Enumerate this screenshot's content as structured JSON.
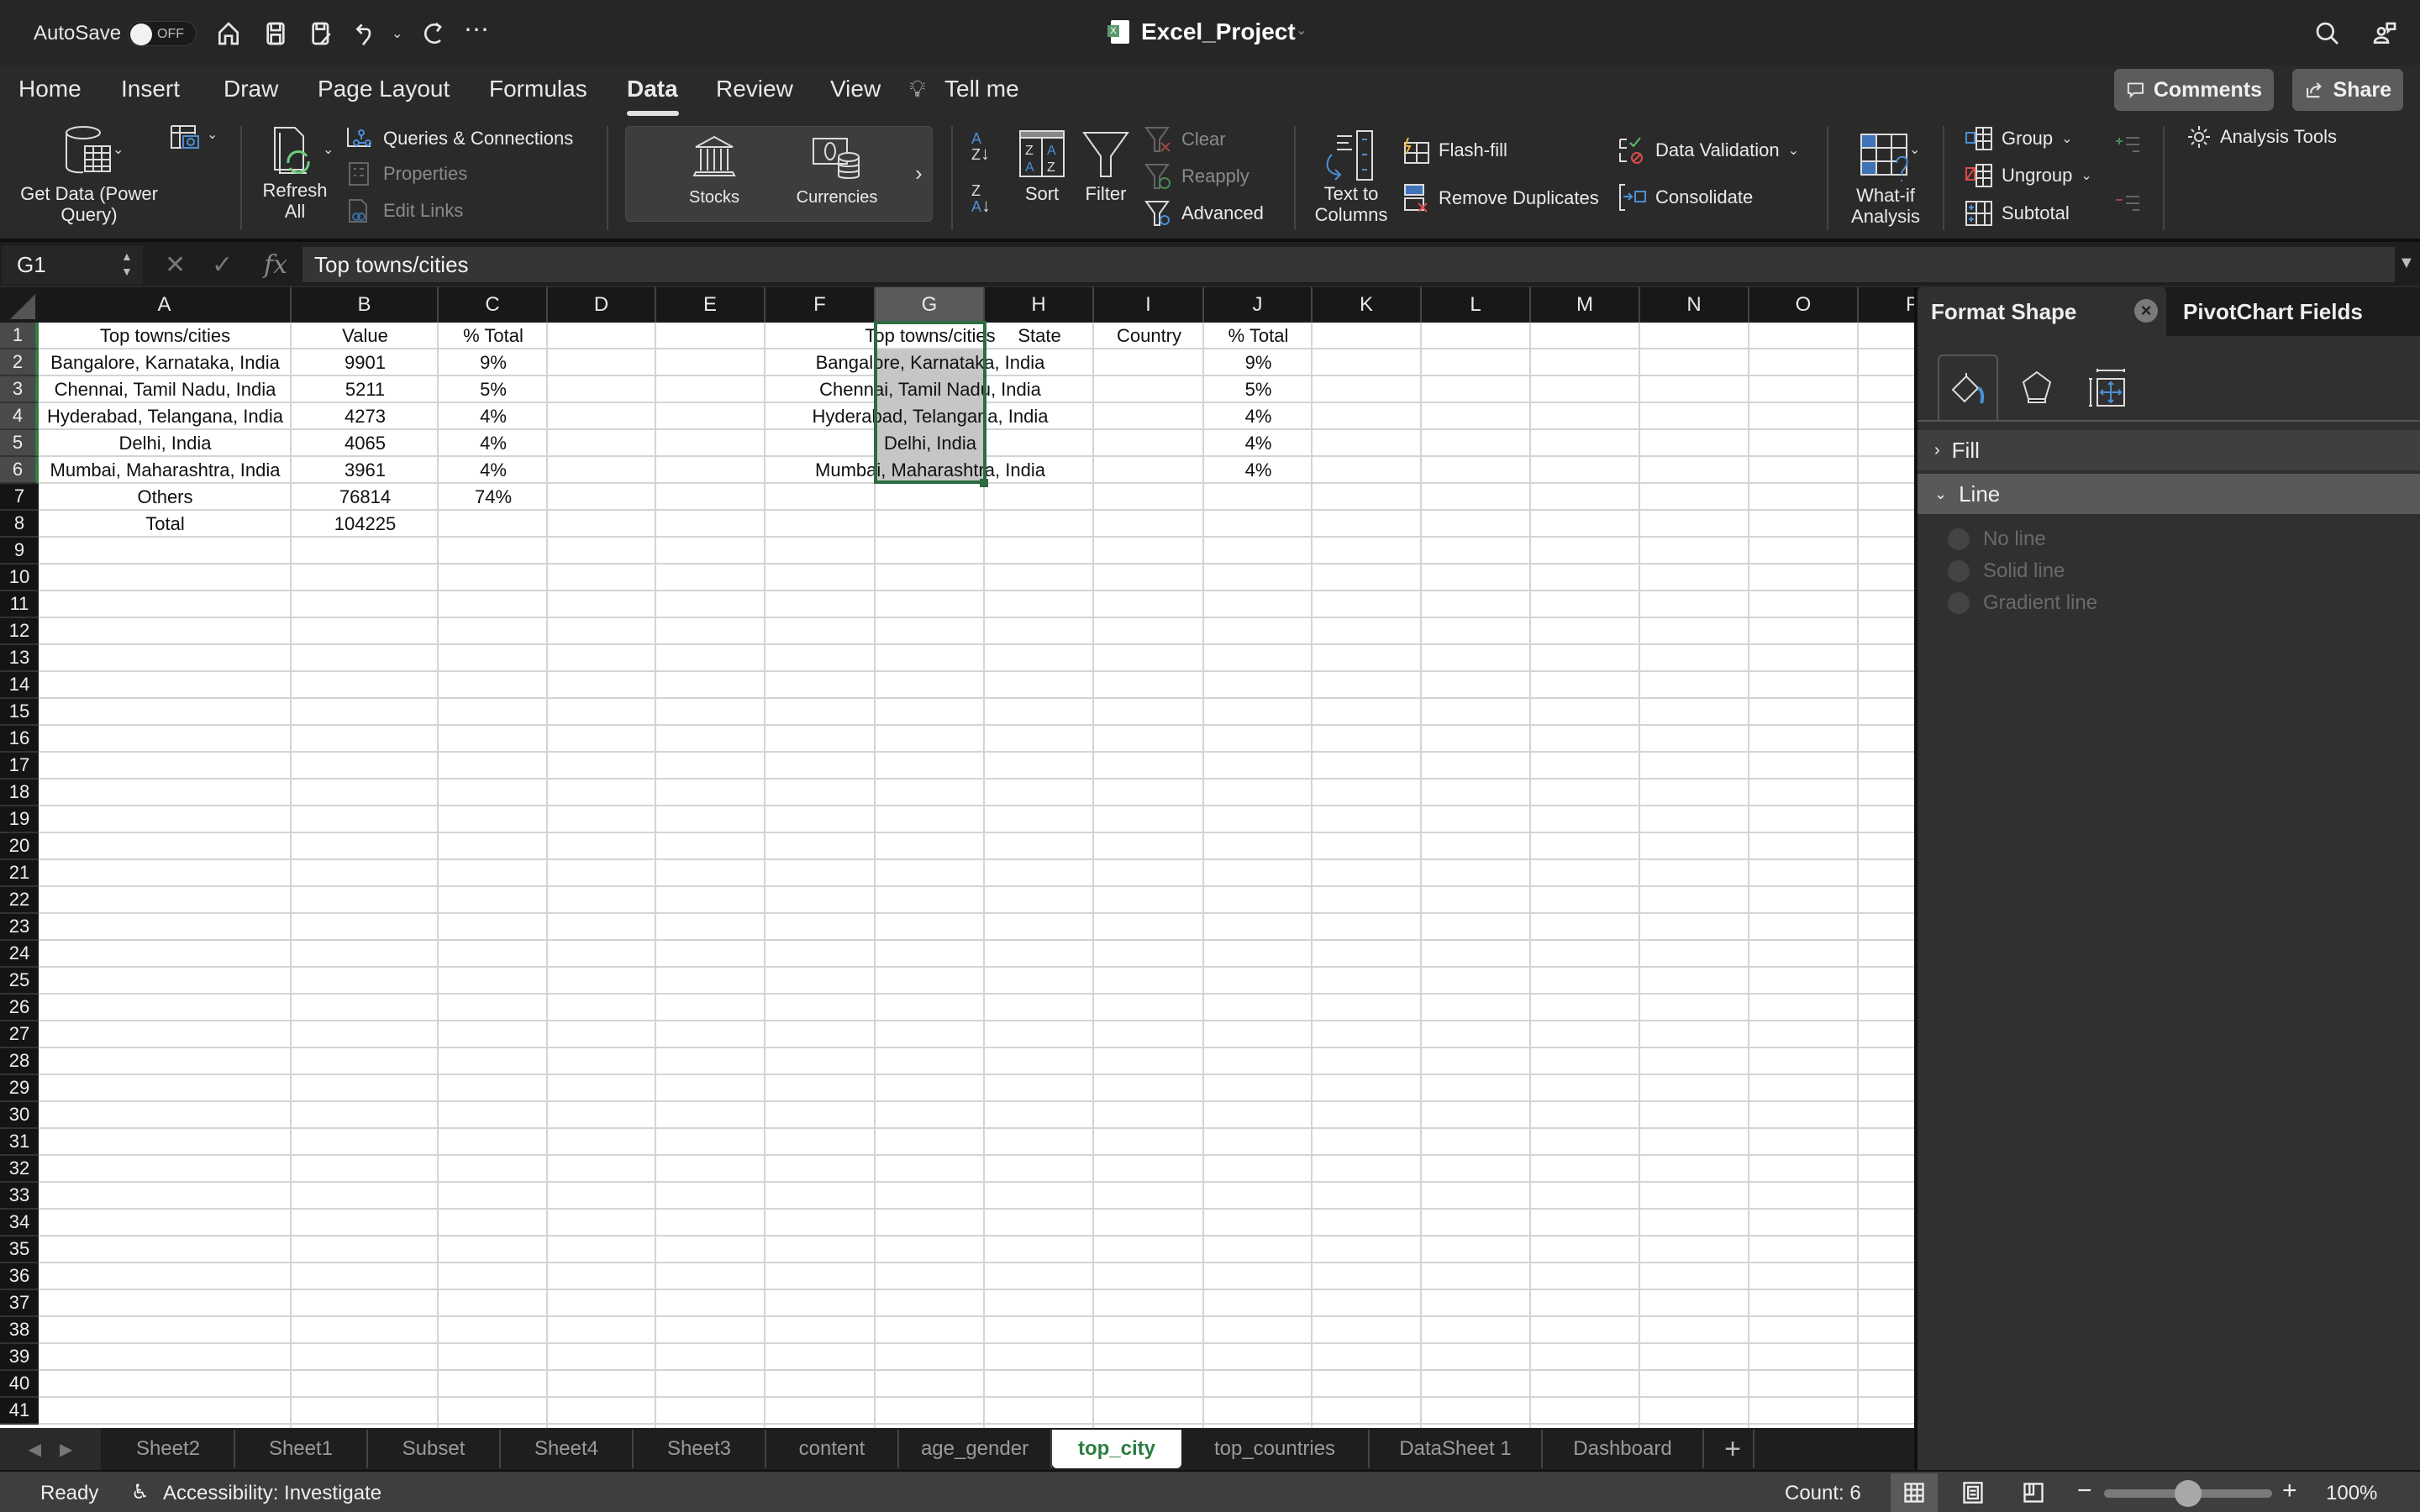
{
  "titlebar": {
    "autosave_label": "AutoSave",
    "autosave_state": "OFF",
    "doc_title": "Excel_Project",
    "quick_access": [
      "home-icon",
      "save-icon",
      "save-as-icon",
      "undo-icon",
      "redo-icon",
      "more-icon"
    ]
  },
  "tabs": [
    {
      "label": "Home"
    },
    {
      "label": "Insert"
    },
    {
      "label": "Draw"
    },
    {
      "label": "Page Layout"
    },
    {
      "label": "Formulas"
    },
    {
      "label": "Data",
      "active": true
    },
    {
      "label": "Review"
    },
    {
      "label": "View"
    },
    {
      "label": "Tell me"
    }
  ],
  "header_buttons": {
    "comments": "Comments",
    "share": "Share"
  },
  "ribbon": {
    "get_data": "Get Data (Power Query)",
    "refresh_all": "Refresh All",
    "queries_connections": "Queries & Connections",
    "properties": "Properties",
    "edit_links": "Edit Links",
    "stocks": "Stocks",
    "currencies": "Currencies",
    "sort": "Sort",
    "filter": "Filter",
    "clear": "Clear",
    "reapply": "Reapply",
    "advanced": "Advanced",
    "text_to_columns": "Text to Columns",
    "flash_fill": "Flash-fill",
    "remove_duplicates": "Remove Duplicates",
    "data_validation": "Data Validation",
    "consolidate": "Consolidate",
    "what_if": "What-if Analysis",
    "group": "Group",
    "ungroup": "Ungroup",
    "subtotal": "Subtotal",
    "analysis_tools": "Analysis Tools"
  },
  "formula_bar": {
    "name_box": "G1",
    "fx": "fx",
    "formula": "Top towns/cities"
  },
  "grid": {
    "columns": [
      "A",
      "B",
      "C",
      "D",
      "E",
      "F",
      "G",
      "H",
      "I",
      "J",
      "K",
      "L",
      "M",
      "N",
      "O",
      "P"
    ],
    "selected_column": "G",
    "row_count": 41,
    "selected_rows": [
      1,
      2,
      3,
      4,
      5,
      6
    ],
    "table1": {
      "headers": [
        "Top towns/cities",
        "Value",
        "% Total"
      ],
      "rows": [
        [
          "Bangalore, Karnataka, India",
          "9901",
          "9%"
        ],
        [
          "Chennai, Tamil Nadu, India",
          "5211",
          "5%"
        ],
        [
          "Hyderabad, Telangana, India",
          "4273",
          "4%"
        ],
        [
          "Delhi, India",
          "4065",
          "4%"
        ],
        [
          "Mumbai, Maharashtra, India",
          "3961",
          "4%"
        ],
        [
          "Others",
          "76814",
          "74%"
        ],
        [
          "Total",
          "104225",
          ""
        ]
      ]
    },
    "table2": {
      "headers": [
        "Top towns/cities",
        "State",
        "Country",
        "% Total"
      ],
      "rows": [
        [
          "Bangalore, Karnataka, India",
          "",
          "",
          "9%"
        ],
        [
          "Chennai, Tamil Nadu, India",
          "",
          "",
          "5%"
        ],
        [
          "Hyderabad, Telangana, India",
          "",
          "",
          "4%"
        ],
        [
          "Delhi, India",
          "",
          "",
          "4%"
        ],
        [
          "Mumbai, Maharashtra, India",
          "",
          "",
          "4%"
        ]
      ]
    }
  },
  "pane": {
    "active_tab": "Format Shape",
    "other_tab": "PivotChart Fields",
    "icon_tabs": [
      "fill-line-icon",
      "effects-icon",
      "size-properties-icon"
    ],
    "sections": {
      "fill": "Fill",
      "line": "Line"
    },
    "line_options": [
      "No line",
      "Solid line",
      "Gradient line"
    ]
  },
  "sheet_tabs": [
    {
      "label": "Sheet2"
    },
    {
      "label": "Sheet1"
    },
    {
      "label": "Subset"
    },
    {
      "label": "Sheet4"
    },
    {
      "label": "Sheet3"
    },
    {
      "label": "content"
    },
    {
      "label": "age_gender"
    },
    {
      "label": "top_city",
      "active": true
    },
    {
      "label": "top_countries"
    },
    {
      "label": "DataSheet 1"
    },
    {
      "label": "Dashboard"
    }
  ],
  "status": {
    "ready": "Ready",
    "accessibility": "Accessibility: Investigate",
    "count": "Count: 6",
    "zoom": "100%",
    "zoom_fraction": 0.5
  },
  "colors": {
    "accent_green": "#2e7d42",
    "selection_fill": "#c6c6c6"
  }
}
